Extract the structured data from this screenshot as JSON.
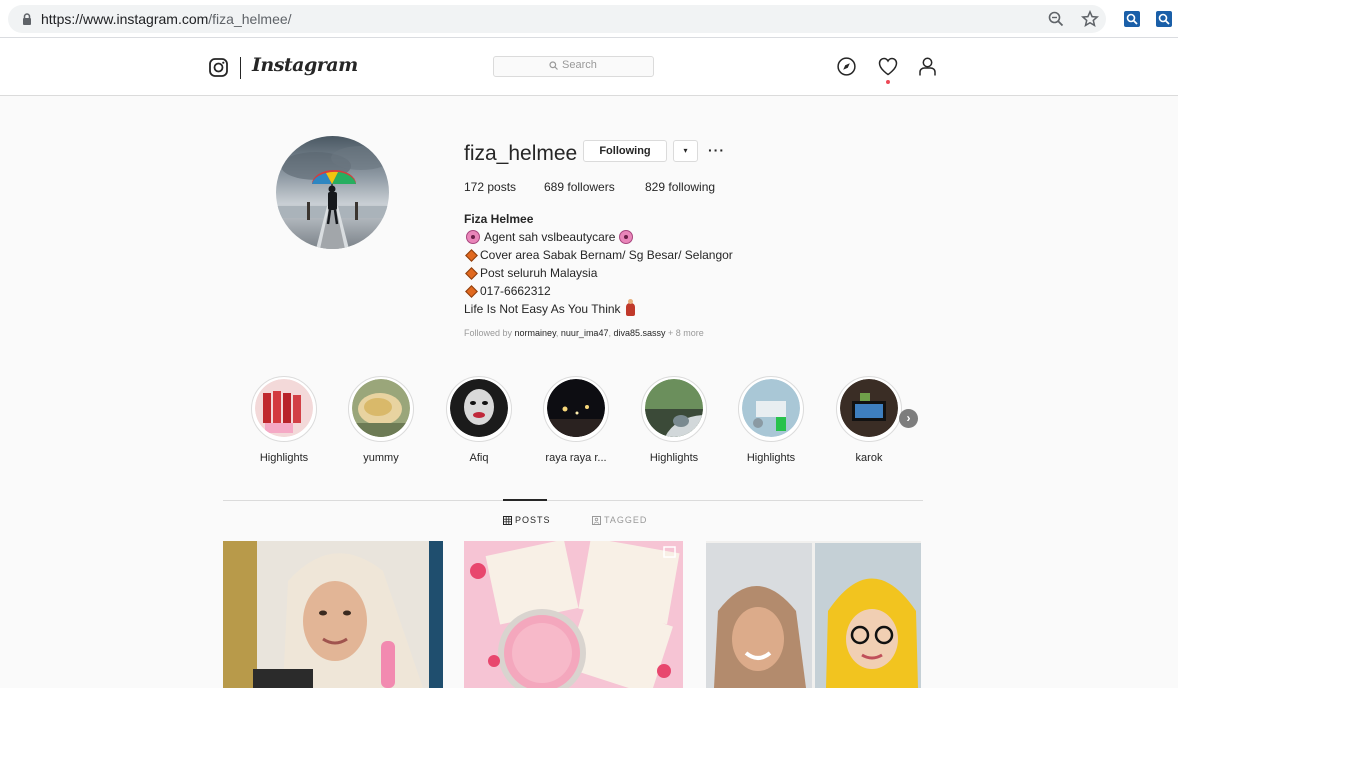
{
  "browser": {
    "url_host": "https://www.instagram.com",
    "url_path": "/fiza_helmee/"
  },
  "nav": {
    "wordmark": "Instagram",
    "search_placeholder": "Search"
  },
  "profile": {
    "username": "fiza_helmee",
    "following_label": "Following",
    "more_label": "···",
    "dropdown_label": "▾",
    "stats": {
      "posts_count": "172",
      "posts_label": "posts",
      "followers_count": "689",
      "followers_label": "followers",
      "following_count": "829",
      "following_label": "following"
    },
    "full_name": "Fiza Helmee",
    "bio_lines": [
      "Agent sah vslbeautycare",
      "Cover area Sabak Bernam/ Sg Besar/ Selangor",
      "Post seluruh Malaysia",
      "017-6662312",
      "Life Is Not Easy As You Think"
    ],
    "followed_by_prefix": "Followed by",
    "followed_by_users": [
      "normainey",
      "nuur_ima47",
      "diva85.sassy"
    ],
    "followed_by_more": "+ 8 more"
  },
  "highlights": [
    {
      "label": "Highlights"
    },
    {
      "label": "yummy"
    },
    {
      "label": "Afiq"
    },
    {
      "label": "raya raya r..."
    },
    {
      "label": "Highlights"
    },
    {
      "label": "Highlights"
    },
    {
      "label": "karok"
    }
  ],
  "tabs": {
    "posts": "POSTS",
    "tagged": "TAGGED"
  }
}
